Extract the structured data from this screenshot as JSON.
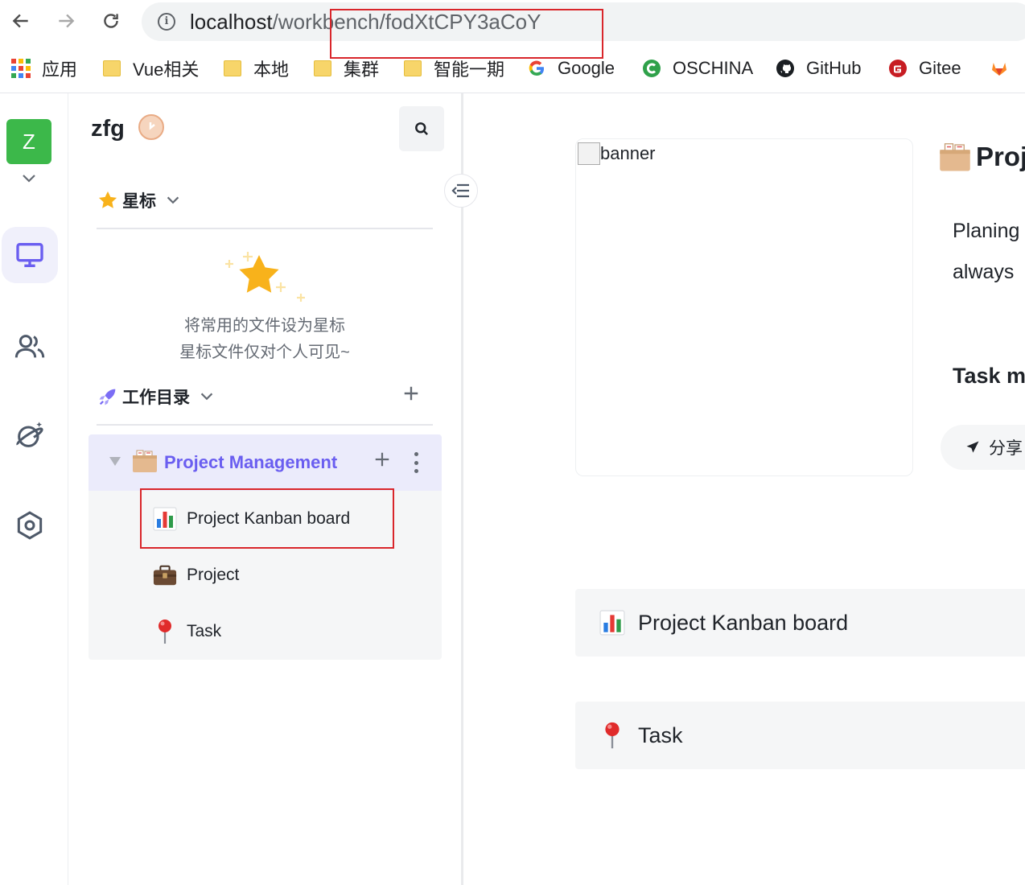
{
  "browser": {
    "url_host": "localhost",
    "url_path": "/workbench/fodXtCPY3aCoY",
    "bookmarks": [
      {
        "label": "应用",
        "icon": "apps-grid-icon"
      },
      {
        "label": "Vue相关",
        "icon": "folder-icon"
      },
      {
        "label": "本地",
        "icon": "folder-icon"
      },
      {
        "label": "集群",
        "icon": "folder-icon"
      },
      {
        "label": "智能一期",
        "icon": "folder-icon"
      },
      {
        "label": "Google",
        "icon": "google-icon"
      },
      {
        "label": "OSCHINA",
        "icon": "oschina-icon"
      },
      {
        "label": "GitHub",
        "icon": "github-icon"
      },
      {
        "label": "Gitee",
        "icon": "gitee-icon"
      }
    ]
  },
  "rail": {
    "avatar_letter": "Z",
    "items": [
      {
        "name": "workbench",
        "icon": "monitor-icon",
        "active": true
      },
      {
        "name": "members",
        "icon": "users-icon",
        "active": false
      },
      {
        "name": "explore",
        "icon": "planet-icon",
        "active": false
      },
      {
        "name": "settings",
        "icon": "settings-hexagon-icon",
        "active": false
      }
    ]
  },
  "sidebar": {
    "workspace_name": "zfg",
    "starred": {
      "label": "星标",
      "empty_line1": "将常用的文件设为星标",
      "empty_line2": "星标文件仅对个人可见~"
    },
    "workdir": {
      "label": "工作目录",
      "root": {
        "label": "Project Management"
      },
      "children": [
        {
          "label": "Project Kanban board",
          "icon": "bar-chart-icon"
        },
        {
          "label": "Project",
          "icon": "briefcase-icon"
        },
        {
          "label": "Task",
          "icon": "pushpin-icon"
        }
      ]
    }
  },
  "main": {
    "banner_alt": "banner",
    "title": "Proj",
    "line1": "Planing",
    "line2": "always",
    "subheading": "Task m",
    "share_label": "分享",
    "cards": [
      {
        "label": "Project Kanban board",
        "icon": "bar-chart-icon"
      },
      {
        "label": "Task",
        "icon": "pushpin-icon"
      }
    ]
  },
  "colors": {
    "accent": "#6a5ef0",
    "avatar_bg": "#3cb84a",
    "highlight_box": "#d9262b",
    "star": "#f8b21b"
  }
}
